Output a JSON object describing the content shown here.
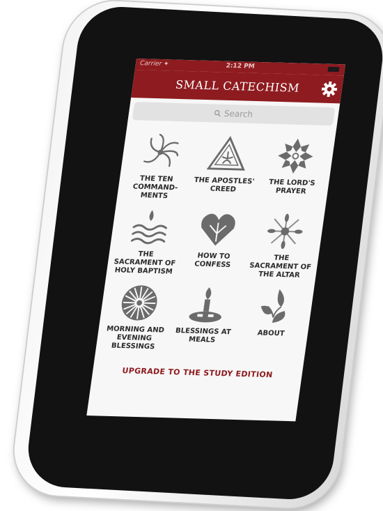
{
  "status": {
    "carrier": "Carrier ✦",
    "time": "2:12 PM"
  },
  "nav": {
    "title": "SMALL CATECHISM",
    "settings_icon": "gear-icon"
  },
  "search": {
    "placeholder": "Search",
    "icon": "search-icon"
  },
  "tiles": [
    {
      "label": "THE TEN\nCOMMAND-\nMENTS",
      "icon": "swirl-icon"
    },
    {
      "label": "THE APOSTLES'\nCREED",
      "icon": "triangle-icon"
    },
    {
      "label": "THE LORD'S\nPRAYER",
      "icon": "flower-icon"
    },
    {
      "label": "THE\nSACRAMENT OF\nHOLY BAPTISM",
      "icon": "water-icon"
    },
    {
      "label": "HOW TO\nCONFESS",
      "icon": "heart-icon"
    },
    {
      "label": "THE\nSACRAMENT OF\nTHE ALTAR",
      "icon": "wheat-icon"
    },
    {
      "label": "MORNING AND\nEVENING\nBLESSINGS",
      "icon": "sunburst-icon"
    },
    {
      "label": "BLESSINGS AT\nMEALS",
      "icon": "candle-icon"
    },
    {
      "label": "ABOUT",
      "icon": "flame-icon"
    }
  ],
  "upgrade_label": "UPGRADE TO THE STUDY EDITION",
  "colors": {
    "accent": "#8e1b1f",
    "icon": "#6b6b6b"
  }
}
